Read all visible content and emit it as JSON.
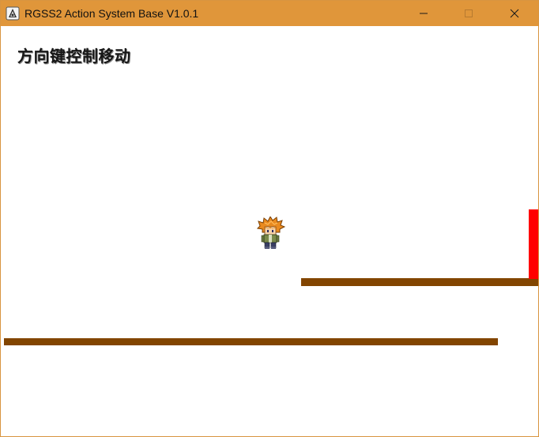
{
  "window": {
    "title": "RGSS2 Action System Base V1.0.1",
    "icon": "rgss-app-icon",
    "controls": {
      "minimize_icon": "minimize-icon",
      "maximize_icon": "maximize-icon",
      "close_icon": "close-icon"
    },
    "titlebar_color": "#e0963a"
  },
  "game": {
    "hint_text": "方向键控制移动",
    "player_sprite": "hero-character-sprite",
    "platform_color": "#824500",
    "wall_color": "#ff0000",
    "background_color": "#ffffff"
  }
}
